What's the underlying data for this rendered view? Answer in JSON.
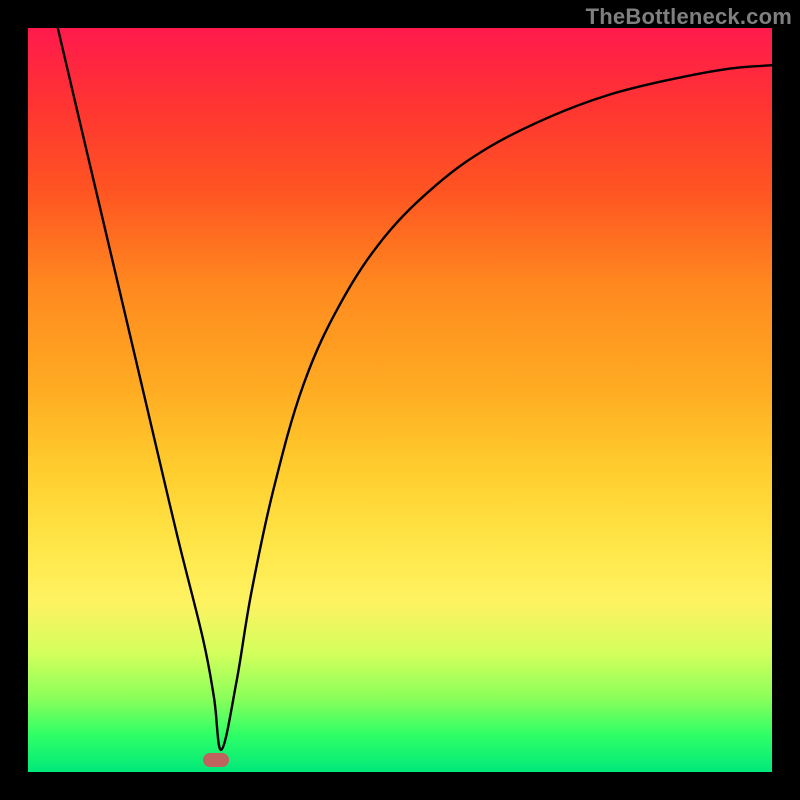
{
  "watermark": "TheBottleneck.com",
  "chart_data": {
    "type": "line",
    "title": "",
    "xlabel": "",
    "ylabel": "",
    "xlim": [
      0,
      100
    ],
    "ylim": [
      0,
      100
    ],
    "series": [
      {
        "name": "curve",
        "x": [
          4,
          8,
          12,
          16,
          20,
          23.5,
          25,
          26,
          28,
          30,
          33,
          37,
          42,
          48,
          55,
          62,
          70,
          78,
          86,
          94,
          100
        ],
        "y": [
          100,
          83,
          66,
          49,
          32,
          18,
          10,
          3,
          12,
          24,
          38,
          52,
          63,
          72,
          79,
          84,
          88,
          91,
          93,
          94.5,
          95
        ]
      }
    ],
    "marker": {
      "x": 25.3,
      "y": 1.6
    },
    "gradient_colors": [
      "#ff1a4d",
      "#ff3333",
      "#ff8a1f",
      "#ffcf2e",
      "#ffe74a",
      "#8cff5a",
      "#00e87a"
    ]
  }
}
